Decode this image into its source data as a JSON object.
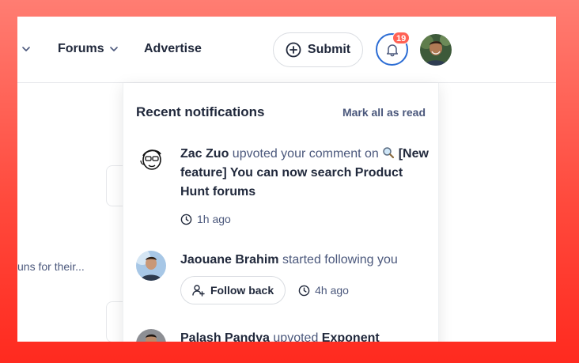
{
  "nav": {
    "forums_label": "Forums",
    "advertise_label": "Advertise",
    "submit_label": "Submit",
    "notification_count": "19"
  },
  "background": {
    "snippet": "uns for their..."
  },
  "notifications": {
    "title": "Recent notifications",
    "mark_all_label": "Mark all as read",
    "items": [
      {
        "actor": "Zac Zuo",
        "action": "upvoted your comment on",
        "target_icon": "magnifier-icon",
        "target": "[New feature] You can now search Product Hunt forums",
        "time": "1h ago"
      },
      {
        "actor": "Jaouane Brahim",
        "action": "started following you",
        "button": "Follow back",
        "time": "4h ago"
      },
      {
        "actor": "Palash Pandya",
        "action": "upvoted",
        "target": "Exponent"
      }
    ]
  },
  "colors": {
    "accent_blue": "#2b6cd4",
    "badge_red": "#ff6154",
    "text_dark": "#21293c",
    "text_muted": "#4b587c"
  }
}
